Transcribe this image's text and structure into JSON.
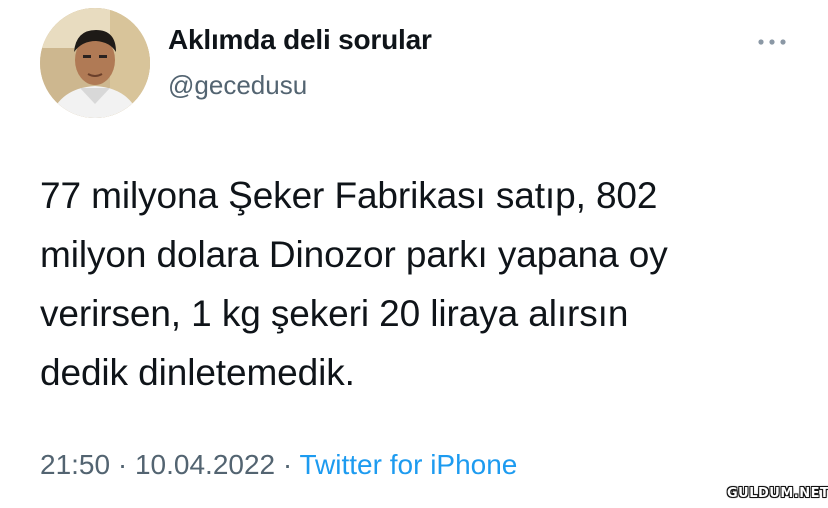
{
  "author": {
    "display_name": "Aklımda deli sorular",
    "handle": "@gecedusu"
  },
  "more_icon": "more-horizontal-icon",
  "tweet": {
    "lines": [
      "77 milyona Şeker Fabrikası satıp, 802",
      "milyon dolara Dinozor parkı yapana oy",
      "verirsen, 1 kg şekeri 20 liraya alırsın",
      "dedik dinletemedik."
    ]
  },
  "meta": {
    "time": "21:50",
    "separator1": " · ",
    "date": "10.04.2022",
    "separator2": " · ",
    "source": "Twitter for iPhone"
  },
  "watermark": "GULDUM.NET",
  "colors": {
    "text": "#0f1419",
    "secondary": "#536471",
    "link": "#1d9bf0",
    "background": "#ffffff"
  }
}
